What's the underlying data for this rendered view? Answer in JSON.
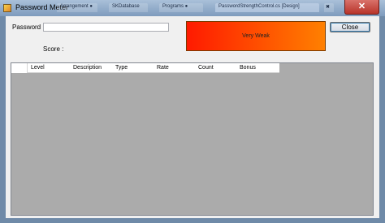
{
  "window": {
    "title": "Password Meter",
    "close_glyph": "✕",
    "background_tabs": [
      "Arrangement ●",
      "SKDatabase",
      "Programs ●",
      "PasswordStrengthControl.cs [Design]",
      "✖"
    ]
  },
  "form": {
    "password_label": "Password",
    "password_value": "",
    "score_label": "Score :",
    "strength_text": "Very Weak",
    "close_button": "Close"
  },
  "grid": {
    "columns": [
      "Level",
      "Description",
      "Type",
      "Rate",
      "Count",
      "Bonus"
    ]
  },
  "colors": {
    "strength_gradient_start": "#ff1a00",
    "strength_gradient_end": "#ff8000",
    "grid_background": "#ababab"
  }
}
